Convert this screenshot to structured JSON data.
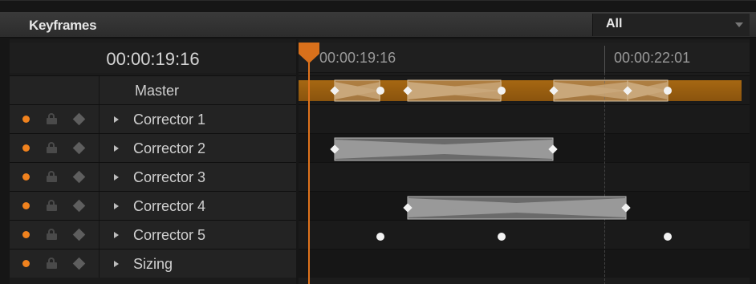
{
  "header": {
    "title": "Keyframes"
  },
  "filter": {
    "selected": "All"
  },
  "current_timecode": "00:00:19:16",
  "ruler": {
    "start_label": "00:00:19:16",
    "marker_label": "00:00:22:01"
  },
  "tracks": [
    {
      "label": "Master"
    },
    {
      "label": "Corrector 1"
    },
    {
      "label": "Corrector 2"
    },
    {
      "label": "Corrector 3"
    },
    {
      "label": "Corrector 4"
    },
    {
      "label": "Corrector 5"
    },
    {
      "label": "Sizing"
    }
  ],
  "colors": {
    "accent": "#e0731c",
    "master_bar": "#9a5e10",
    "enabled_dot": "#f0821e"
  }
}
